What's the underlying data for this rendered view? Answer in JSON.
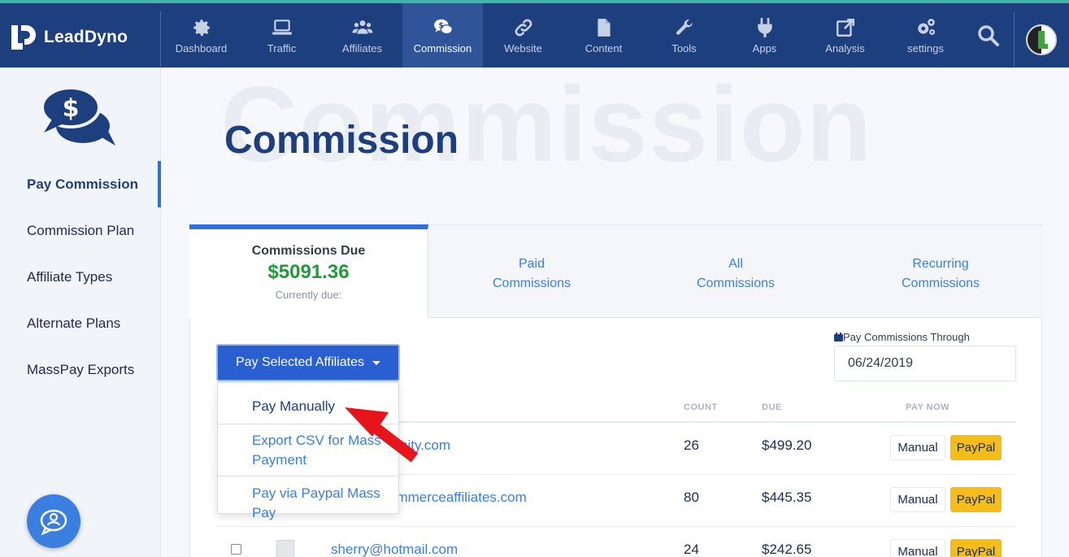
{
  "app": {
    "brand": "LeadDyno"
  },
  "nav": [
    {
      "label": "Dashboard",
      "icon": "gear-icon"
    },
    {
      "label": "Traffic",
      "icon": "laptop-icon"
    },
    {
      "label": "Affiliates",
      "icon": "users-icon"
    },
    {
      "label": "Commission",
      "icon": "commission-chat-icon",
      "active": true
    },
    {
      "label": "Website",
      "icon": "link-icon"
    },
    {
      "label": "Content",
      "icon": "file-icon"
    },
    {
      "label": "Tools",
      "icon": "wrench-icon"
    },
    {
      "label": "Apps",
      "icon": "plug-icon"
    },
    {
      "label": "Analysis",
      "icon": "external-link-icon"
    },
    {
      "label": "settings",
      "icon": "gears-icon"
    }
  ],
  "sidebar": {
    "items": [
      {
        "label": "Pay Commission",
        "active": true
      },
      {
        "label": "Commission Plan"
      },
      {
        "label": "Affiliate Types"
      },
      {
        "label": "Alternate Plans"
      },
      {
        "label": "MassPay Exports"
      }
    ]
  },
  "page": {
    "bg_title": "Commission",
    "title": "Commission"
  },
  "tabs": {
    "due_label": "Commissions Due",
    "due_amount": "$5091.36",
    "due_sub": "Currently due:",
    "paid": [
      "Paid",
      "Commissions"
    ],
    "all": [
      "All",
      "Commissions"
    ],
    "recurring": [
      "Recurring",
      "Commissions"
    ]
  },
  "pay_through": {
    "label": "Pay Commissions Through",
    "value": "06/24/2019"
  },
  "pay_button": {
    "label": "Pay Selected Affiliates"
  },
  "dropdown": {
    "items": [
      [
        "Pay Manually"
      ],
      [
        "Export CSV for Mass",
        "Payment"
      ],
      [
        "Pay via Paypal Mass",
        "Pay"
      ]
    ]
  },
  "table": {
    "headers": {
      "count": "COUNT",
      "due": "DUE",
      "pay_now": "PAY NOW"
    },
    "rows": [
      {
        "email_visible": "nity.com",
        "count": "26",
        "due": "$499.20",
        "manual": "Manual",
        "paypal": "PayPal"
      },
      {
        "email_visible": "ommerceaffiliates.com",
        "count": "80",
        "due": "$445.35",
        "manual": "Manual",
        "paypal": "PayPal"
      },
      {
        "email_visible": "sherry@hotmail.com",
        "count": "24",
        "due": "$242.65",
        "manual": "Manual",
        "paypal": "PayPal"
      }
    ]
  },
  "colors": {
    "nav_bg": "#1e3f7d",
    "nav_active": "#2f5598",
    "accent_blue": "#2a5fd1",
    "amount_green": "#1e9b3a",
    "paypal_yellow": "#f5bd16",
    "arrow_red": "#e8141c"
  }
}
